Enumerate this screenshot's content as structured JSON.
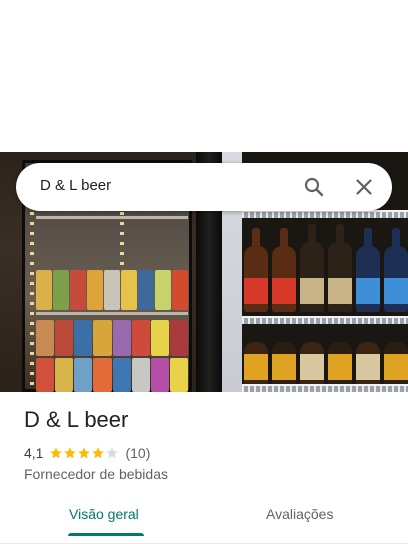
{
  "search": {
    "query": "D & L beer"
  },
  "place": {
    "name": "D & L beer",
    "rating": "4,1",
    "rating_stars": 4.1,
    "review_count": "(10)",
    "category": "Fornecedor de bebidas"
  },
  "tabs": [
    {
      "label": "Visão geral",
      "active": true
    },
    {
      "label": "Avaliações",
      "active": false
    }
  ],
  "colors": {
    "accent": "#00796b",
    "star": "#fbbc04",
    "star_empty": "#dadce0"
  },
  "icons": {
    "search": "search-icon",
    "close": "close-icon"
  }
}
